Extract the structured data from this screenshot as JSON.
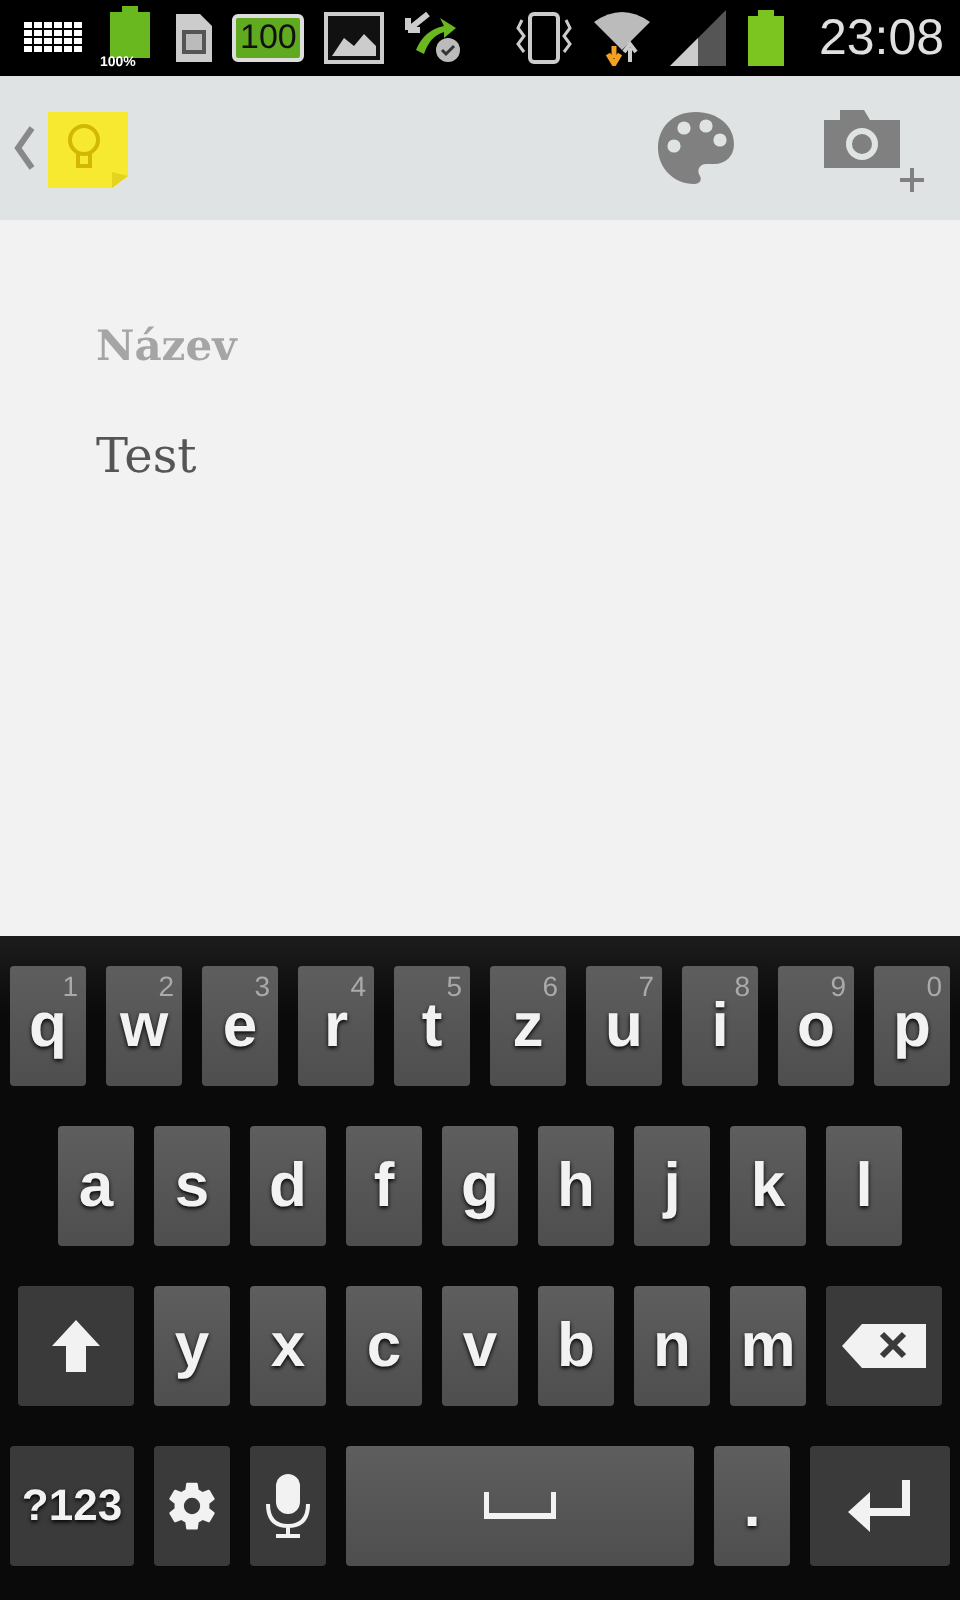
{
  "status_bar": {
    "battery_percent": "100%",
    "battery_badge": "100",
    "time": "23:08"
  },
  "note": {
    "title": {
      "placeholder": "Název"
    },
    "body": {
      "value": "Test"
    }
  },
  "keyboard": {
    "rows": [
      {
        "keys": [
          {
            "kind": "char",
            "label": "q",
            "hint": "1"
          },
          {
            "kind": "char",
            "label": "w",
            "hint": "2"
          },
          {
            "kind": "char",
            "label": "e",
            "hint": "3"
          },
          {
            "kind": "char",
            "label": "r",
            "hint": "4"
          },
          {
            "kind": "char",
            "label": "t",
            "hint": "5"
          },
          {
            "kind": "char",
            "label": "z",
            "hint": "6"
          },
          {
            "kind": "char",
            "label": "u",
            "hint": "7"
          },
          {
            "kind": "char",
            "label": "i",
            "hint": "8"
          },
          {
            "kind": "char",
            "label": "o",
            "hint": "9"
          },
          {
            "kind": "char",
            "label": "p",
            "hint": "0"
          }
        ]
      },
      {
        "keys": [
          {
            "kind": "char",
            "label": "a"
          },
          {
            "kind": "char",
            "label": "s"
          },
          {
            "kind": "char",
            "label": "d"
          },
          {
            "kind": "char",
            "label": "f"
          },
          {
            "kind": "char",
            "label": "g"
          },
          {
            "kind": "char",
            "label": "h"
          },
          {
            "kind": "char",
            "label": "j"
          },
          {
            "kind": "char",
            "label": "k"
          },
          {
            "kind": "char",
            "label": "l"
          }
        ]
      },
      {
        "keys": [
          {
            "kind": "shift"
          },
          {
            "kind": "char",
            "label": "y"
          },
          {
            "kind": "char",
            "label": "x"
          },
          {
            "kind": "char",
            "label": "c"
          },
          {
            "kind": "char",
            "label": "v"
          },
          {
            "kind": "char",
            "label": "b"
          },
          {
            "kind": "char",
            "label": "n"
          },
          {
            "kind": "char",
            "label": "m"
          },
          {
            "kind": "backspace"
          }
        ]
      },
      {
        "keys": [
          {
            "kind": "symbols",
            "label": "?123"
          },
          {
            "kind": "settings"
          },
          {
            "kind": "mic"
          },
          {
            "kind": "space"
          },
          {
            "kind": "period",
            "label": "."
          },
          {
            "kind": "enter"
          }
        ]
      }
    ]
  }
}
